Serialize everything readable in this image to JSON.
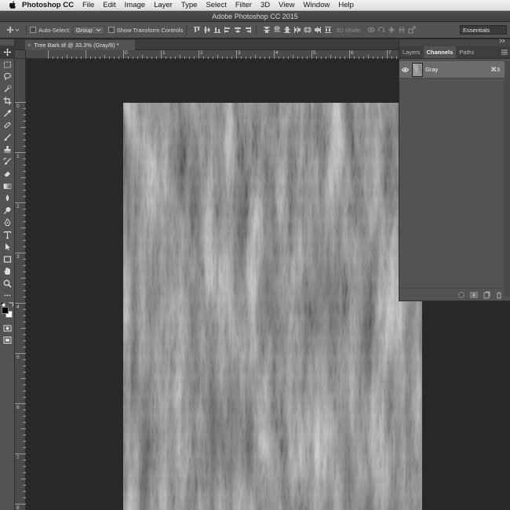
{
  "menubar": {
    "app_name": "Photoshop CC",
    "items": [
      "File",
      "Edit",
      "Image",
      "Layer",
      "Type",
      "Select",
      "Filter",
      "3D",
      "View",
      "Window",
      "Help"
    ]
  },
  "window": {
    "title": "Adobe Photoshop CC 2015"
  },
  "options": {
    "auto_select_label": "Auto-Select:",
    "auto_select_value": "Group",
    "show_transform_label": "Show Transform Controls",
    "mode_3d_label": "3D Mode:",
    "workspace": "Essentials"
  },
  "document": {
    "tab_title": "Tree Bark.tif @ 33.3% (Gray/8) *",
    "close_glyph": "×",
    "ruler_top_labels": [
      "0",
      "1",
      "2",
      "3",
      "4",
      "5",
      "6",
      "7"
    ],
    "ruler_left_labels": [
      "0",
      "1",
      "2",
      "3",
      "4",
      "5",
      "6",
      "7",
      "8"
    ]
  },
  "panel": {
    "tabs": [
      "Layers",
      "Channels",
      "Paths"
    ],
    "active_tab": "Channels",
    "channel": {
      "name": "Gray",
      "shortcut": "⌘3",
      "visible": true
    }
  },
  "icons": {
    "apple": "apple-icon",
    "move": "move-icon",
    "eye": "eye-icon"
  },
  "colors": {
    "foreground": "#000000",
    "background": "#ffffff"
  }
}
